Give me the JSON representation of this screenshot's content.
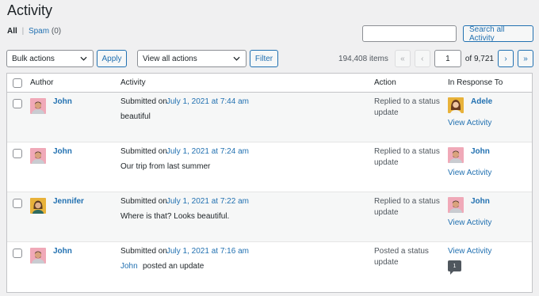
{
  "header": {
    "title": "Activity"
  },
  "filters": {
    "all_label": "All",
    "separator": "|",
    "spam_label": "Spam",
    "spam_count": "(0)"
  },
  "search": {
    "value": "",
    "button_label": "Search all Activity"
  },
  "tablenav": {
    "bulk_actions": "Bulk actions",
    "apply_label": "Apply",
    "view_actions": "View all actions",
    "filter_label": "Filter",
    "items_count": "194,408 items",
    "first_label": "«",
    "prev_label": "‹",
    "page_current": "1",
    "page_total": "of 9,721",
    "next_label": "›",
    "last_label": "»"
  },
  "columns": {
    "author": "Author",
    "activity": "Activity",
    "action": "Action",
    "response": "In Response To"
  },
  "rows": [
    {
      "author": "John",
      "submitted_prefix": "Submitted on",
      "submitted_date": "July 1, 2021 at 7:44 am",
      "content": "beautiful",
      "action": "Replied to a status update",
      "response_author": "Adele",
      "view_label": "View Activity",
      "avatar": "john"
    },
    {
      "author": "John",
      "submitted_prefix": "Submitted on",
      "submitted_date": "July 1, 2021 at 7:24 am",
      "content": "Our trip from last summer",
      "action": "Replied to a status update",
      "response_author": "John",
      "view_label": "View Activity",
      "avatar": "john"
    },
    {
      "author": "Jennifer",
      "submitted_prefix": "Submitted on",
      "submitted_date": "July 1, 2021 at 7:22 am",
      "content": "Where is that? Looks beautiful.",
      "action": "Replied to a status update",
      "response_author": "John",
      "view_label": "View Activity",
      "avatar": "jennifer"
    },
    {
      "author": "John",
      "submitted_prefix": "Submitted on",
      "submitted_date": "July 1, 2021 at 7:16 am",
      "content_link": "John",
      "content_rest": "posted an update",
      "action": "Posted a status update",
      "view_label": "View Activity",
      "comment_count": "1",
      "avatar": "john"
    }
  ],
  "colors": {
    "link": "#2271b1",
    "background": "#f0f0f1",
    "border": "#c3c4c7"
  }
}
